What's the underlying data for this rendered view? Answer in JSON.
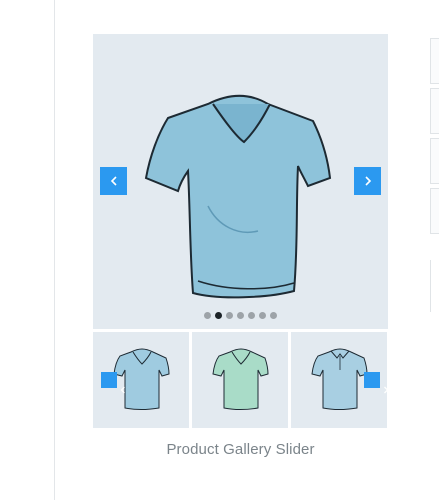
{
  "gallery": {
    "caption": "Product Gallery Slider",
    "active_dot": 1,
    "dot_count": 7,
    "prev_icon": "chevron-left-icon",
    "next_icon": "chevron-right-icon",
    "thumbnails": [
      {
        "name": "thumb-blue-vneck",
        "color": "#9fcbe0"
      },
      {
        "name": "thumb-mint-vneck",
        "color": "#a9dcc8"
      },
      {
        "name": "thumb-polo",
        "color": "#a8cfe2"
      }
    ]
  },
  "colors": {
    "accent": "#2b99f0",
    "slide_bg": "#e3eaf0",
    "shirt_blue": "#8ec3da",
    "shirt_mint": "#a9dcc8",
    "caption": "#7b848a"
  }
}
